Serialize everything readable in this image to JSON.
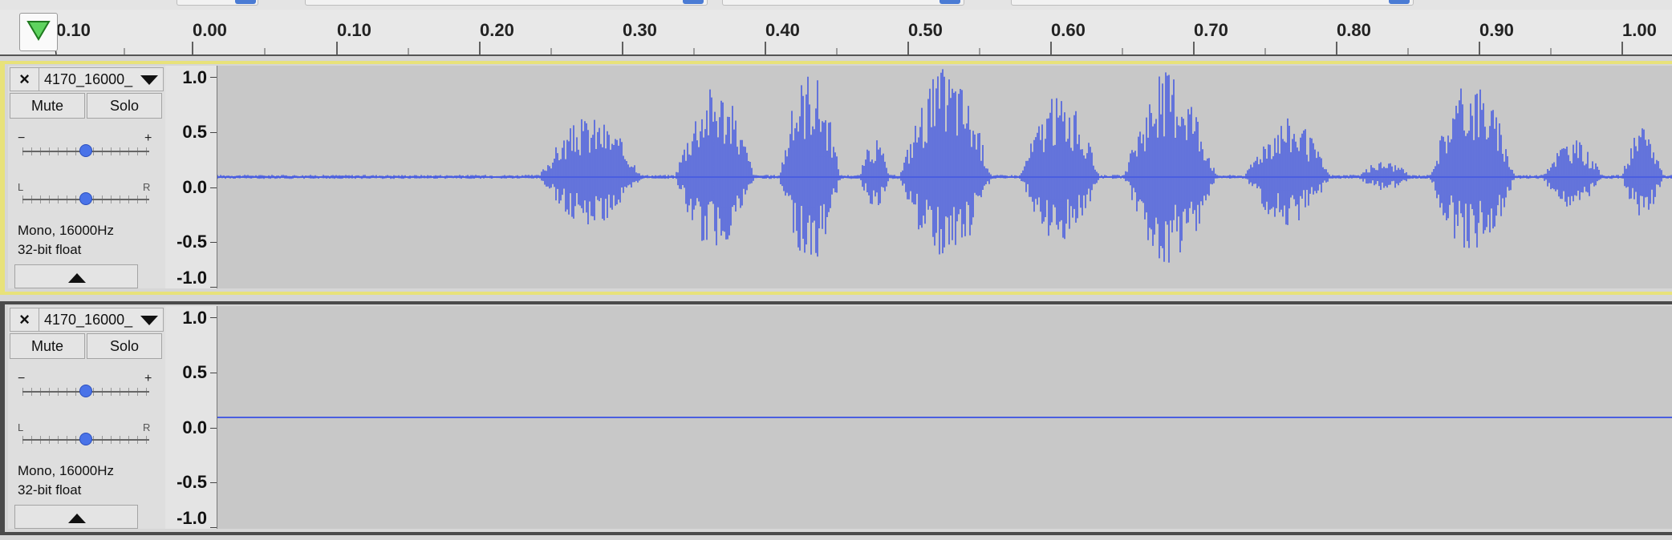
{
  "timeline": {
    "ruler_labels": [
      "0.10",
      "0.00",
      "0.10",
      "0.20",
      "0.30",
      "0.40",
      "0.50",
      "0.60",
      "0.70",
      "0.80",
      "0.90",
      "1.00"
    ],
    "play_icon": "play-head-triangle-icon"
  },
  "tracks": [
    {
      "name": "4170_16000_",
      "close_label": "×",
      "mute_label": "Mute",
      "solo_label": "Solo",
      "gain_minus": "−",
      "gain_plus": "+",
      "pan_left": "L",
      "pan_right": "R",
      "format_line1": "Mono, 16000Hz",
      "format_line2": "32-bit float",
      "amplitude_labels": [
        "1.0",
        "0.5",
        "0.0",
        "-0.5",
        "-1.0"
      ],
      "selected": true,
      "waveform": "speech"
    },
    {
      "name": "4170_16000_",
      "close_label": "×",
      "mute_label": "Mute",
      "solo_label": "Solo",
      "gain_minus": "−",
      "gain_plus": "+",
      "pan_left": "L",
      "pan_right": "R",
      "format_line1": "Mono, 16000Hz",
      "format_line2": "32-bit float",
      "amplitude_labels": [
        "1.0",
        "0.5",
        "0.0",
        "-0.5",
        "-1.0"
      ],
      "selected": false,
      "waveform": "silence"
    }
  ],
  "colors": {
    "waveform": "#4a5ee0",
    "selection_border": "#e8e27a",
    "slider_thumb": "#4a73e8"
  }
}
